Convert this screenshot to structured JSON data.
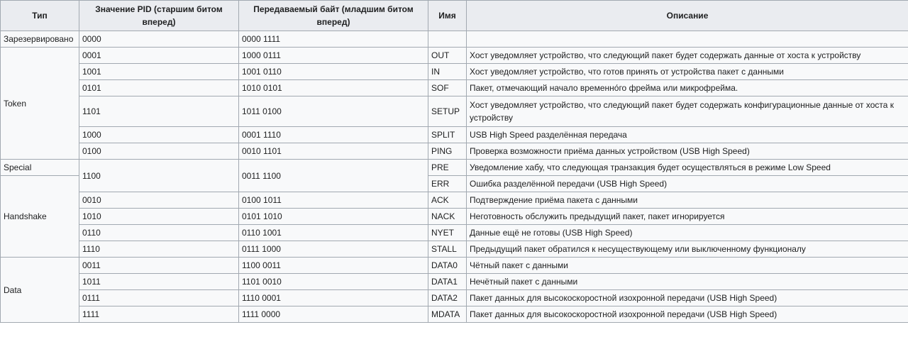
{
  "headers": {
    "type": "Тип",
    "pid": "Значение PID (старшим битом вперед)",
    "byte": "Передаваемый байт (младшим битом вперед)",
    "name": "Имя",
    "desc": "Описание"
  },
  "groups": {
    "reserved": "Зарезервировано",
    "token": "Token",
    "special": "Special",
    "handshake": "Handshake",
    "data": "Data"
  },
  "rows": [
    {
      "pid": "0000",
      "byte": "0000 1111",
      "name": "",
      "desc": ""
    },
    {
      "pid": "0001",
      "byte": "1000 0111",
      "name": "OUT",
      "desc": "Хост уведомляет устройство, что следующий пакет будет содержать данные от хоста к устройству"
    },
    {
      "pid": "1001",
      "byte": "1001 0110",
      "name": "IN",
      "desc": "Хост уведомляет устройство, что готов принять от устройства пакет с данными"
    },
    {
      "pid": "0101",
      "byte": "1010 0101",
      "name": "SOF",
      "desc": "Пакет, отмечающий начало временно́го фрейма или микрофрейма."
    },
    {
      "pid": "1101",
      "byte": "1011 0100",
      "name": "SETUP",
      "desc": "Хост уведомляет устройство, что следующий пакет будет содержать конфигурационные данные от хоста к устройству"
    },
    {
      "pid": "1000",
      "byte": "0001 1110",
      "name": "SPLIT",
      "desc": "USB High Speed разделённая передача"
    },
    {
      "pid": "0100",
      "byte": "0010 1101",
      "name": "PING",
      "desc": "Проверка возможности приёма данных устройством (USB High Speed)"
    },
    {
      "pid": "1100",
      "byte": "0011 1100",
      "name": "PRE",
      "desc": "Уведомление хабу, что следующая транзакция будет осуществляться в режиме Low Speed"
    },
    {
      "pid": "",
      "byte": "",
      "name": "ERR",
      "desc": "Ошибка разделённой передачи (USB High Speed)"
    },
    {
      "pid": "0010",
      "byte": "0100 1011",
      "name": "ACK",
      "desc": "Подтверждение приёма пакета с данными"
    },
    {
      "pid": "1010",
      "byte": "0101 1010",
      "name": "NACK",
      "desc": "Неготовность обслужить предыдущий пакет, пакет игнорируется"
    },
    {
      "pid": "0110",
      "byte": "0110 1001",
      "name": "NYET",
      "desc": "Данные ещё не готовы (USB High Speed)"
    },
    {
      "pid": "1110",
      "byte": "0111 1000",
      "name": "STALL",
      "desc": "Предыдущий пакет обратился к несуществующему или выключенному функционалу"
    },
    {
      "pid": "0011",
      "byte": "1100 0011",
      "name": "DATA0",
      "desc": "Чётный пакет с данными"
    },
    {
      "pid": "1011",
      "byte": "1101 0010",
      "name": "DATA1",
      "desc": "Нечётный пакет с данными"
    },
    {
      "pid": "0111",
      "byte": "1110 0001",
      "name": "DATA2",
      "desc": "Пакет данных для высокоскоростной изохронной передачи (USB High Speed)"
    },
    {
      "pid": "1111",
      "byte": "1111 0000",
      "name": "MDATA",
      "desc": "Пакет данных для высокоскоростной изохронной передачи (USB High Speed)"
    }
  ]
}
